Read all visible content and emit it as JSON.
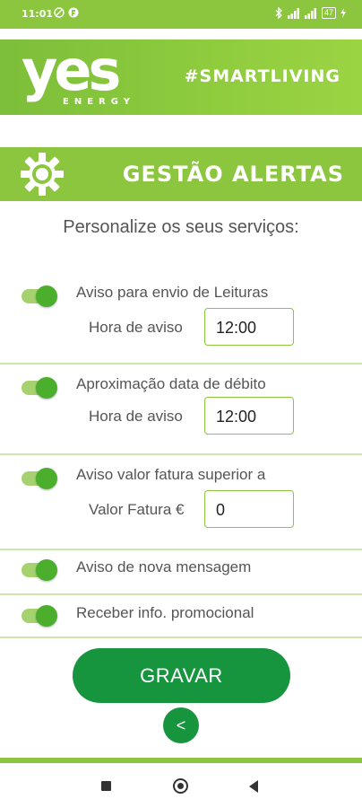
{
  "status_bar": {
    "time": "11:01",
    "battery": "47"
  },
  "header": {
    "logo_main": "yes",
    "logo_sub": "ENERGY",
    "hashtag": "#SMARTLIVING"
  },
  "section": {
    "title": "GESTÃO ALERTAS",
    "icon": "gear-icon"
  },
  "subtitle": "Personalize os seus serviços:",
  "alerts": [
    {
      "label": "Aviso para envio de Leituras",
      "enabled": true,
      "field_label": "Hora de aviso",
      "field_value": "12:00"
    },
    {
      "label": "Aproximação data de débito",
      "enabled": true,
      "field_label": "Hora de aviso",
      "field_value": "12:00"
    },
    {
      "label": "Aviso valor fatura superior a",
      "enabled": true,
      "field_label": "Valor Fatura €",
      "field_value": "0"
    },
    {
      "label": "Aviso de nova mensagem",
      "enabled": true
    },
    {
      "label": "Receber info. promocional",
      "enabled": true
    }
  ],
  "buttons": {
    "save": "GRAVAR",
    "back": "<"
  },
  "colors": {
    "brand_green": "#8cc63f",
    "button_green": "#16953e",
    "toggle_knob": "#4bae2d",
    "toggle_track": "#a5d26e"
  }
}
